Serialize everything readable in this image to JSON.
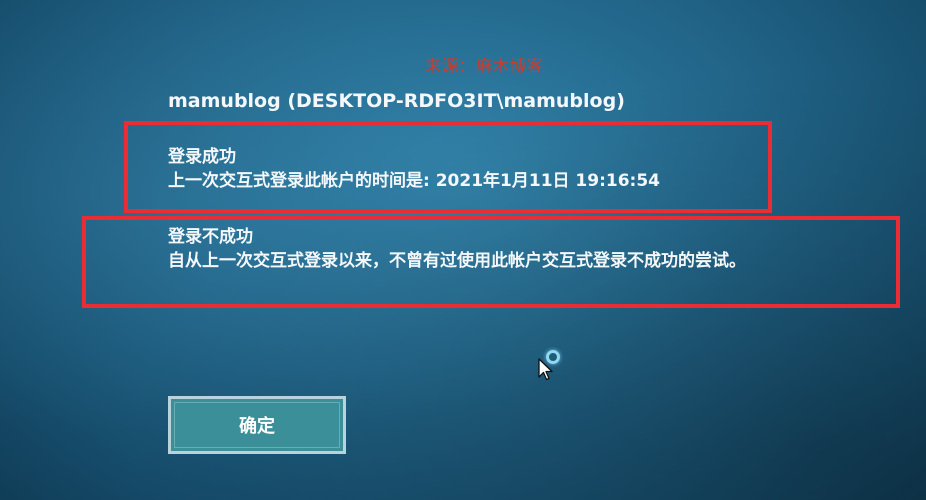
{
  "watermark": "来源：麻木博客",
  "account": {
    "title": "mamublog (DESKTOP-RDFO3IT\\mamublog)"
  },
  "login_success": {
    "heading": "登录成功",
    "detail": "上一次交互式登录此帐户的时间是: 2021年1月11日 19:16:54"
  },
  "login_fail": {
    "heading": "登录不成功",
    "detail": "自从上一次交互式登录以来，不曾有过使用此帐户交互式登录不成功的尝试。"
  },
  "confirm_button": {
    "label": "确定"
  },
  "colors": {
    "background": "#22668a",
    "highlight_box": "#ea2d35",
    "watermark": "#d23a2a",
    "button": "#3b8f99"
  },
  "icons": {
    "cursor": "pointer-busy-icon"
  }
}
